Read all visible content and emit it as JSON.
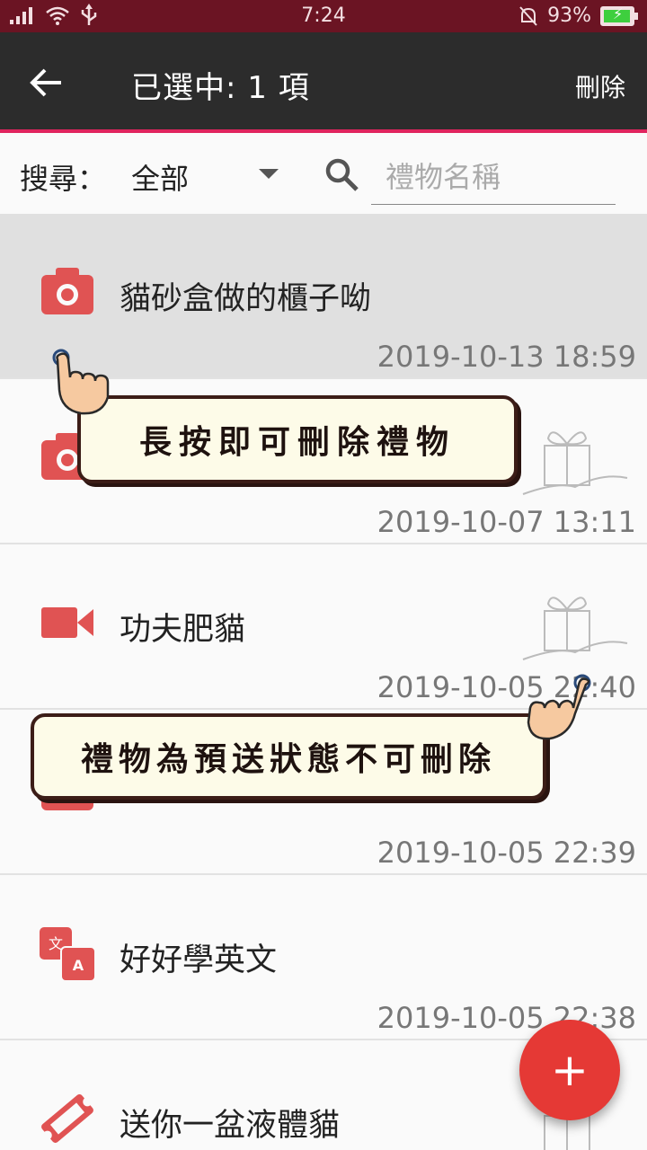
{
  "status_bar": {
    "time": "7:24",
    "battery": "93%"
  },
  "app_bar": {
    "title": "已選中: 1 項",
    "delete_label": "刪除"
  },
  "search": {
    "label": "搜尋：",
    "filter_value": "全部",
    "placeholder": "禮物名稱"
  },
  "gifts": [
    {
      "name": "貓砂盒做的櫃子呦",
      "date": "2019-10-13 18:59",
      "icon": "camera-icon",
      "selected": true
    },
    {
      "name": "",
      "date": "2019-10-07 13:11",
      "icon": "camera-icon",
      "selected": false
    },
    {
      "name": "功夫肥貓",
      "date": "2019-10-05 22:40",
      "icon": "video-icon",
      "selected": false
    },
    {
      "name": "",
      "date": "2019-10-05 22:39",
      "icon": "camera-icon",
      "selected": false
    },
    {
      "name": "好好學英文",
      "date": "2019-10-05 22:38",
      "icon": "translate-icon",
      "selected": false
    },
    {
      "name": "送你一盆液體貓",
      "date": "",
      "icon": "ticket-icon",
      "selected": false
    }
  ],
  "tooltips": {
    "long_press": "長按即可刪除禮物",
    "pre_sent": "禮物為預送狀態不可刪除"
  },
  "colors": {
    "accent": "#e0245e",
    "icon_red": "#e05353",
    "fab": "#e53935",
    "status_bar": "#6b1423",
    "app_bar": "#2c2c2c"
  }
}
